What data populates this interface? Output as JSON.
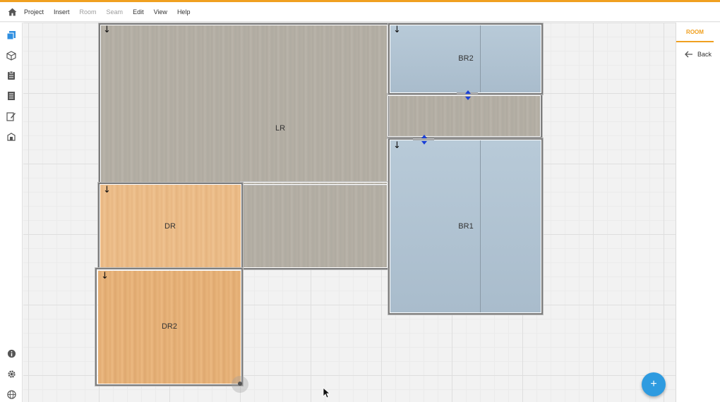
{
  "menubar": {
    "home_icon": "home-icon",
    "items": [
      {
        "label": "Project",
        "enabled": true
      },
      {
        "label": "Insert",
        "enabled": true
      },
      {
        "label": "Room",
        "enabled": false
      },
      {
        "label": "Seam",
        "enabled": false
      },
      {
        "label": "Edit",
        "enabled": true
      },
      {
        "label": "View",
        "enabled": true
      },
      {
        "label": "Help",
        "enabled": true
      }
    ]
  },
  "rail": {
    "top_icons": [
      "pages-icon",
      "cube-icon",
      "clipboard-icon",
      "list-document-icon",
      "edit-document-icon",
      "layers-icon"
    ],
    "bottom_icons": [
      "info-icon",
      "settings-icon",
      "globe-icon"
    ]
  },
  "rooms": [
    {
      "id": "LR",
      "label": "LR",
      "material": "grey wood"
    },
    {
      "id": "BR2",
      "label": "BR2",
      "material": "blue carpet"
    },
    {
      "id": "BR1",
      "label": "BR1",
      "material": "blue carpet"
    },
    {
      "id": "DR",
      "label": "DR",
      "material": "orange wood"
    },
    {
      "id": "DR2",
      "label": "DR2",
      "material": "orange wood"
    }
  ],
  "direction_arrow_glyph": "↓",
  "right_panel": {
    "tab_label": "ROOM",
    "back_label": "Back"
  },
  "fab": {
    "label": "+"
  },
  "colors": {
    "accent": "#f0a020",
    "fab": "#2e9be0",
    "rail_active": "#2f8fe0",
    "door_arrows": "#1a3fd6"
  }
}
